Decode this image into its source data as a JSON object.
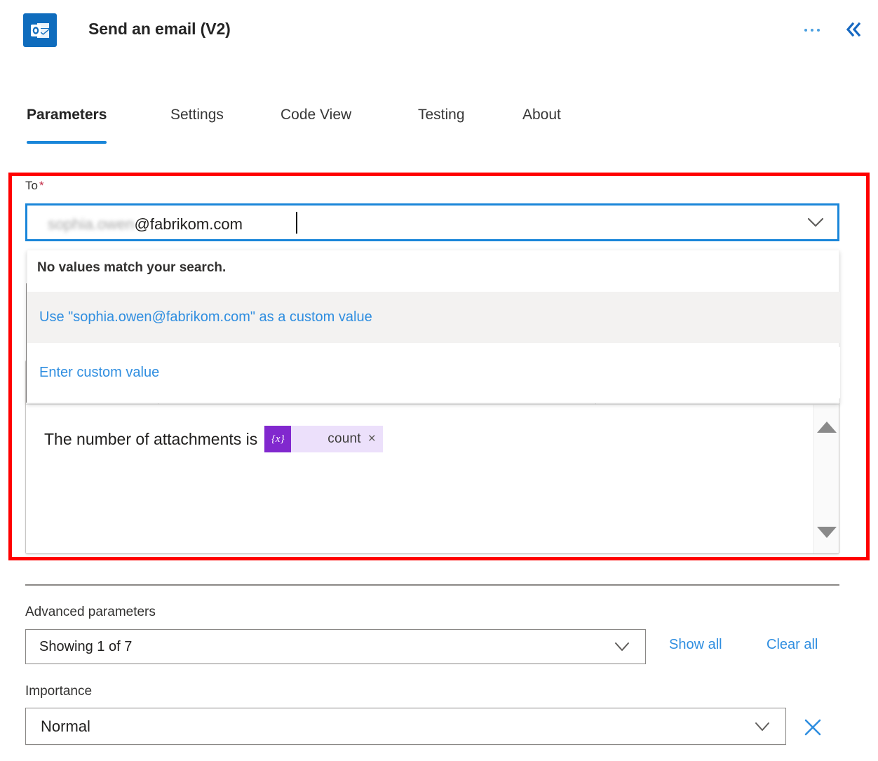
{
  "header": {
    "title": "Send an email (V2)",
    "icon": "outlook-icon",
    "more_icon": "ellipsis-icon",
    "collapse_icon": "double-chevron-left-icon"
  },
  "tabs": [
    {
      "label": "Parameters",
      "active": true
    },
    {
      "label": "Settings",
      "active": false
    },
    {
      "label": "Code View",
      "active": false
    },
    {
      "label": "Testing",
      "active": false
    },
    {
      "label": "About",
      "active": false
    }
  ],
  "to_field": {
    "label": "To",
    "required_marker": "*",
    "value_masked": "sophia.owen",
    "value_visible": "@fabrikom.com",
    "full_value": "sophia.owen@fabrikom.com",
    "chevron_icon": "chevron-down-icon"
  },
  "dropdown": {
    "no_match_message": "No values match your search.",
    "options": [
      {
        "label": "Use \"sophia.owen@fabrikom.com\" as a custom value",
        "highlighted": true
      },
      {
        "label": "Enter custom value",
        "highlighted": false
      }
    ]
  },
  "body_editor": {
    "text_before_token": "The number of attachments is",
    "token": {
      "icon_glyph": "{x}",
      "label": "count",
      "remove_glyph": "×"
    },
    "scroll_up_icon": "triangle-up-icon",
    "scroll_down_icon": "triangle-down-icon"
  },
  "advanced": {
    "section_label": "Advanced parameters",
    "select_value": "Showing 1 of 7",
    "select_chevron_icon": "chevron-down-icon",
    "show_all_label": "Show all",
    "clear_all_label": "Clear all"
  },
  "importance": {
    "label": "Importance",
    "value": "Normal",
    "chevron_icon": "chevron-down-icon",
    "clear_icon": "close-icon"
  },
  "colors": {
    "accent_blue": "#1a86d9",
    "link_blue": "#2f8ee0",
    "brand_blue": "#0f6cbd",
    "required_red": "#c4314b",
    "highlight_red": "#ff0000",
    "token_purple": "#8128ce",
    "token_bg": "#ece0fb"
  }
}
